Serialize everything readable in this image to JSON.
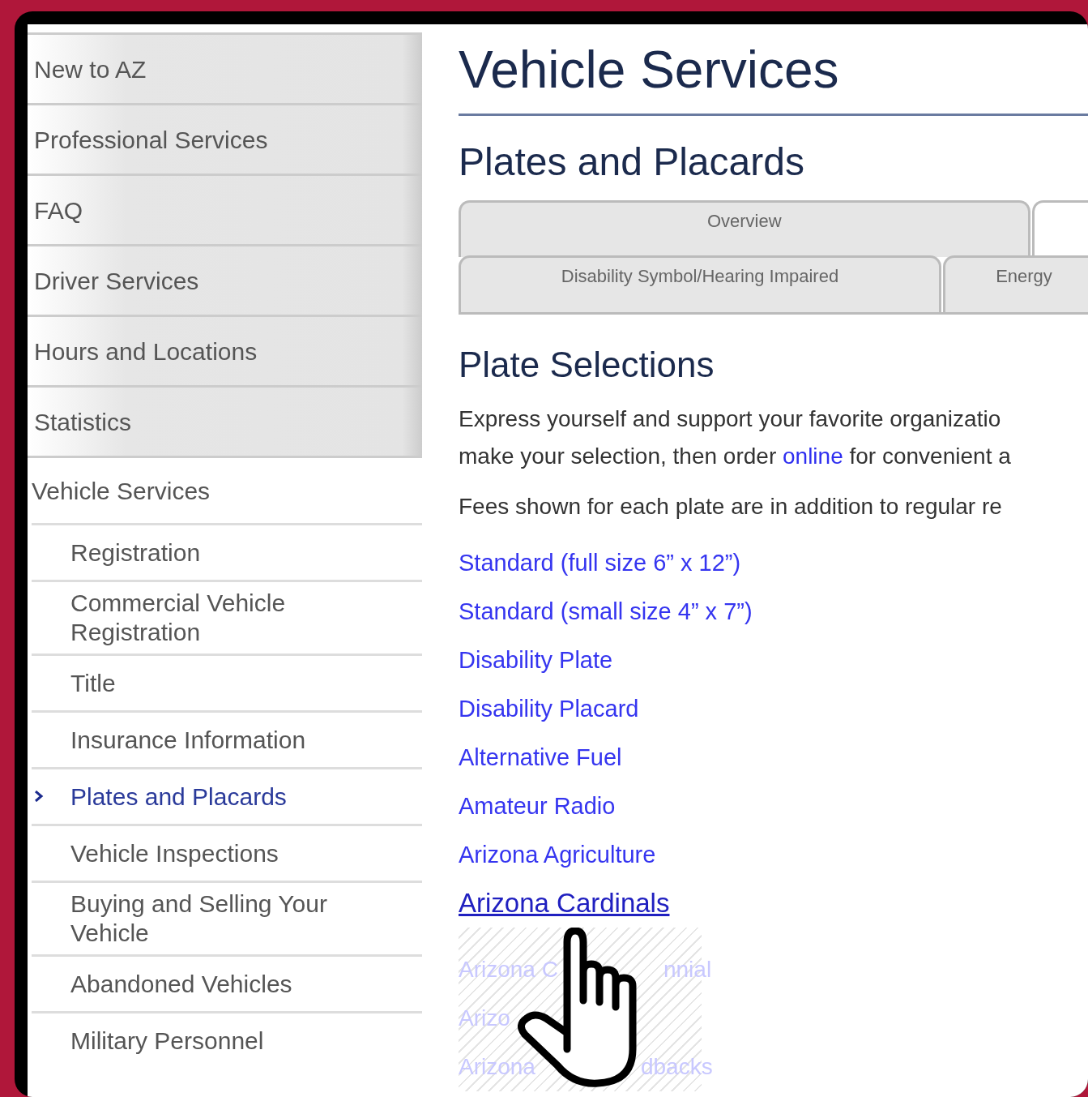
{
  "sidebar": {
    "items": [
      {
        "label": "New to AZ",
        "selected": false
      },
      {
        "label": "Professional Services",
        "selected": false
      },
      {
        "label": "FAQ",
        "selected": false
      },
      {
        "label": "Driver Services",
        "selected": false
      },
      {
        "label": "Hours and Locations",
        "selected": false
      },
      {
        "label": "Statistics",
        "selected": false
      },
      {
        "label": "Vehicle Services",
        "selected": false,
        "expanded": true,
        "children": [
          {
            "label": "Registration",
            "selected": false
          },
          {
            "label": "Commercial Vehicle Registration",
            "selected": false
          },
          {
            "label": "Title",
            "selected": false
          },
          {
            "label": "Insurance Information",
            "selected": false
          },
          {
            "label": "Plates and Placards",
            "selected": true
          },
          {
            "label": "Vehicle Inspections",
            "selected": false
          },
          {
            "label": "Buying and Selling Your Vehicle",
            "selected": false
          },
          {
            "label": "Abandoned Vehicles",
            "selected": false
          },
          {
            "label": "Military Personnel",
            "selected": false
          }
        ]
      }
    ]
  },
  "page_title": "Vehicle Services",
  "section_title": "Plates and Placards",
  "tab_rows": [
    [
      {
        "label": "Overview",
        "selected": false
      },
      {
        "selected": true
      }
    ],
    [
      {
        "label": "Disability Symbol/Hearing Impaired",
        "selected": false
      },
      {
        "label": "Energy",
        "selected": false
      }
    ]
  ],
  "content_title": "Plate Selections",
  "paragraphs": [
    {
      "lines": [
        [
          {
            "text": "Express yourself and support your favorite organizatio",
            "kind": "text"
          }
        ],
        [
          {
            "text": "make your selection, then order",
            "kind": "text"
          },
          {
            "text": "online",
            "kind": "link"
          },
          {
            "text": "for convenient a",
            "kind": "text"
          }
        ]
      ]
    },
    {
      "lines": [
        [
          {
            "text": "Fees shown for each plate are in addition to regular re",
            "kind": "text"
          }
        ]
      ]
    }
  ],
  "links": [
    {
      "label": "Standard (full size 6” x 12”)",
      "hovered": false
    },
    {
      "label": "Standard (small size 4” x 7”)",
      "hovered": false
    },
    {
      "label": "Disability Plate",
      "hovered": false
    },
    {
      "label": "Disability Placard",
      "hovered": false
    },
    {
      "label": "Alternative Fuel",
      "hovered": false
    },
    {
      "label": "Amateur Radio",
      "hovered": false
    },
    {
      "label": "Arizona Agriculture",
      "hovered": false
    },
    {
      "label": "Arizona Cardinals",
      "hovered": true
    }
  ],
  "faded_links": [
    {
      "parts": [
        "Arizona C",
        "nnial"
      ]
    },
    {
      "parts": [
        "Arizo"
      ]
    },
    {
      "parts": [
        "Arizona",
        "dbacks"
      ]
    }
  ]
}
